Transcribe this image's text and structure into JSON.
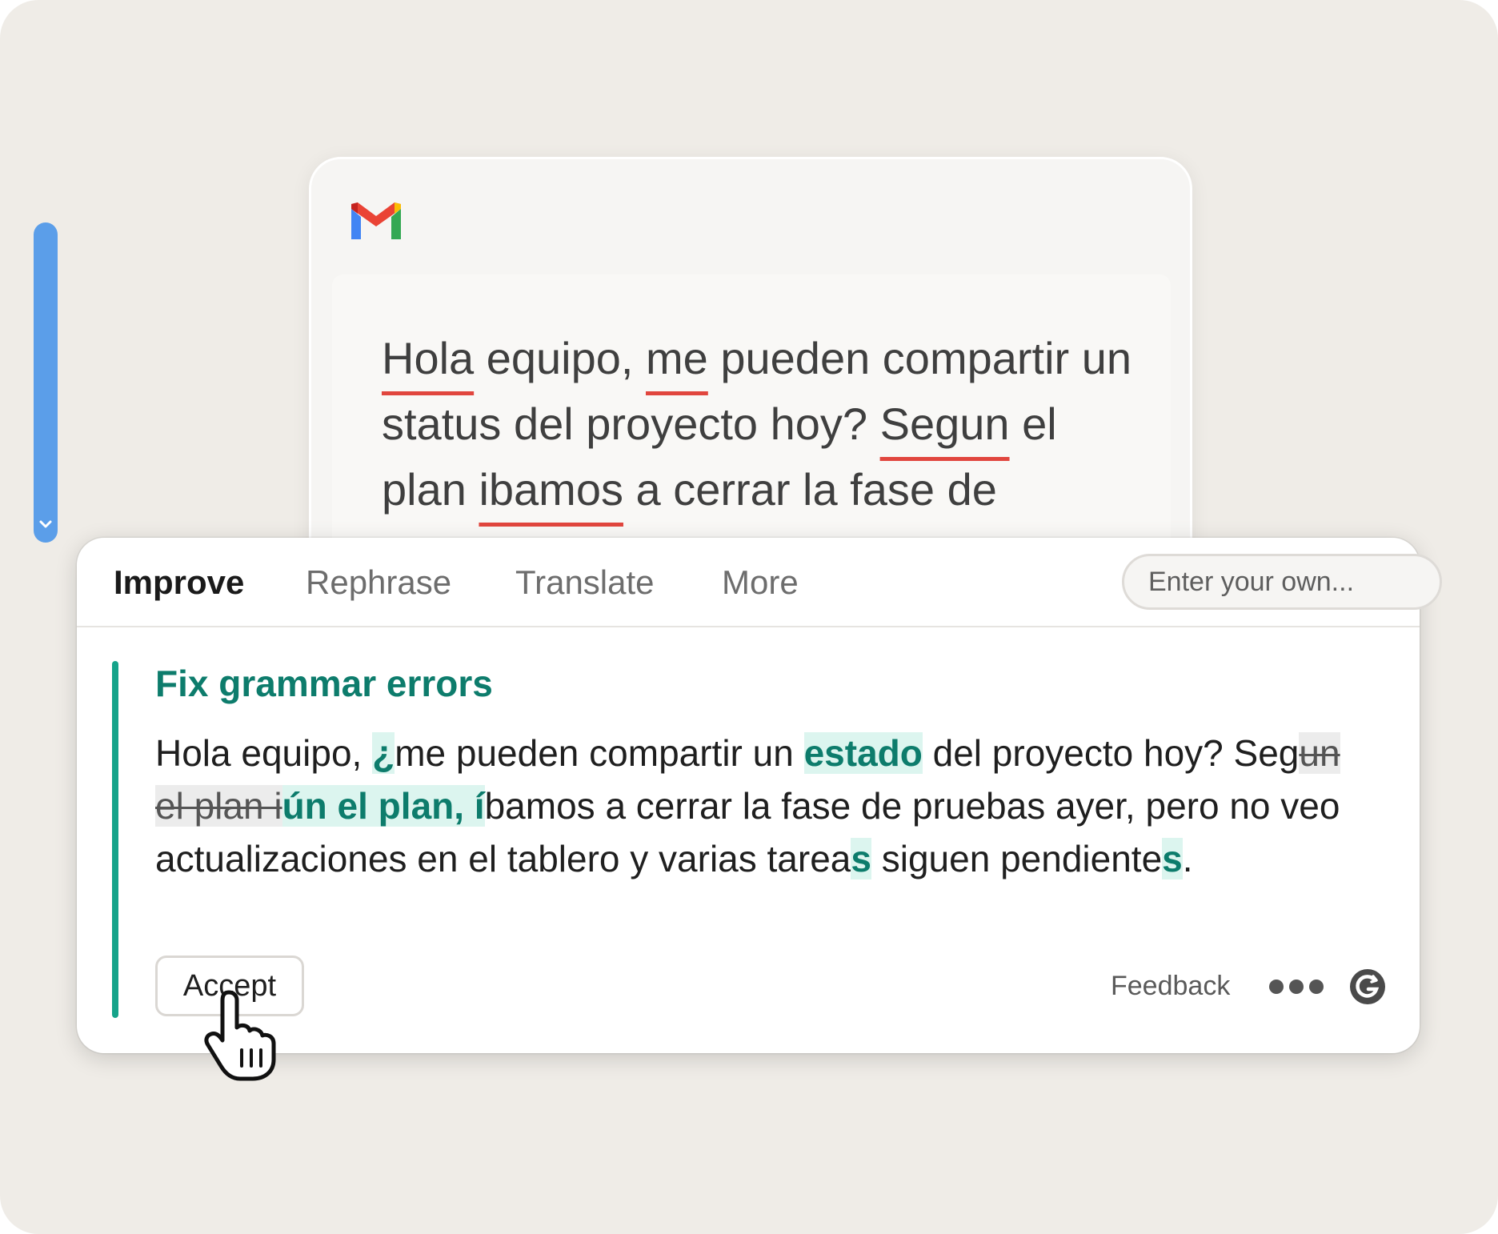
{
  "email": {
    "app": "Gmail",
    "segments": [
      {
        "text": "Hola",
        "error": true
      },
      {
        "text": " equipo, ",
        "error": false
      },
      {
        "text": "me",
        "error": true
      },
      {
        "text": " pueden compartir un status del proyecto hoy? ",
        "error": false
      },
      {
        "text": "Segun",
        "error": true
      },
      {
        "text": " el plan ",
        "error": false
      },
      {
        "text": "ibamos",
        "error": true
      },
      {
        "text": " a cerrar la fase de",
        "error": false
      }
    ]
  },
  "panel": {
    "tabs": [
      {
        "label": "Improve",
        "active": true
      },
      {
        "label": "Rephrase",
        "active": false
      },
      {
        "label": "Translate",
        "active": false
      },
      {
        "label": "More",
        "active": false
      }
    ],
    "custom_prompt_placeholder": "Enter your own...",
    "suggestion": {
      "title": "Fix grammar errors",
      "segments": [
        {
          "text": "Hola equipo, ",
          "type": "plain"
        },
        {
          "text": "¿",
          "type": "insert"
        },
        {
          "text": "me pueden compartir un ",
          "type": "plain"
        },
        {
          "text": "estado",
          "type": "insert"
        },
        {
          "text": " del proyecto hoy? Seg",
          "type": "plain"
        },
        {
          "text": "un el plan i",
          "type": "delete"
        },
        {
          "text": "ún el plan, í",
          "type": "insert"
        },
        {
          "text": "bamos a cerrar la fase de pruebas ayer, pero no veo actualizaciones en el tablero y varias tarea",
          "type": "plain"
        },
        {
          "text": "s",
          "type": "insert"
        },
        {
          "text": " siguen pendiente",
          "type": "plain"
        },
        {
          "text": "s",
          "type": "insert"
        },
        {
          "text": ".",
          "type": "plain"
        }
      ]
    },
    "accept_label": "Accept",
    "feedback_label": "Feedback"
  },
  "colors": {
    "accent_green": "#15a38a",
    "insert_text": "#0d7c6c",
    "insert_bg": "#dcf5ef",
    "error_underline": "#e1463e",
    "text_cursor": "#5b9ee9"
  }
}
